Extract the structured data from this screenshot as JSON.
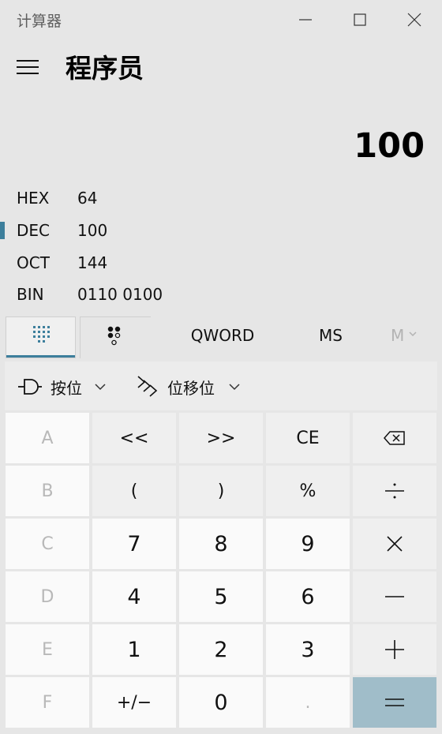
{
  "window": {
    "title": "计算器"
  },
  "header": {
    "mode_title": "程序员"
  },
  "display": {
    "value": "100"
  },
  "radix": [
    {
      "name": "HEX",
      "value": "64",
      "selected": false
    },
    {
      "name": "DEC",
      "value": "100",
      "selected": true
    },
    {
      "name": "OCT",
      "value": "144",
      "selected": false
    },
    {
      "name": "BIN",
      "value": "0110 0100",
      "selected": false
    }
  ],
  "tabs": {
    "qword_label": "QWORD",
    "ms_label": "MS",
    "mlist_label": "M"
  },
  "toolbar": {
    "bitwise_label": "按位",
    "bitshift_label": "位移位"
  },
  "keys": {
    "A": "A",
    "lsh": "<<",
    "rsh": ">>",
    "CE": "CE",
    "B": "B",
    "lparen": "(",
    "rparen": ")",
    "percent": "%",
    "C": "C",
    "seven": "7",
    "eight": "8",
    "nine": "9",
    "D": "D",
    "four": "4",
    "five": "5",
    "six": "6",
    "E": "E",
    "one": "1",
    "two": "2",
    "three": "3",
    "F": "F",
    "negate": "+/−",
    "zero": "0",
    "decimal": "."
  },
  "icons": {
    "hamburger": "hamburger-menu-icon",
    "backspace": "backspace-icon",
    "divide": "divide-icon",
    "multiply": "multiply-icon",
    "minus": "minus-icon",
    "plus": "plus-icon",
    "equals": "equals-icon",
    "keypad": "full-keypad-icon",
    "bits": "bit-toggle-keypad-icon",
    "bitwise": "logic-gate-icon",
    "bitshift": "bit-shift-icon"
  },
  "colors": {
    "accent": "#3d7f9c",
    "equals_key": "#a0bdc9",
    "background": "#e6e6e6"
  }
}
